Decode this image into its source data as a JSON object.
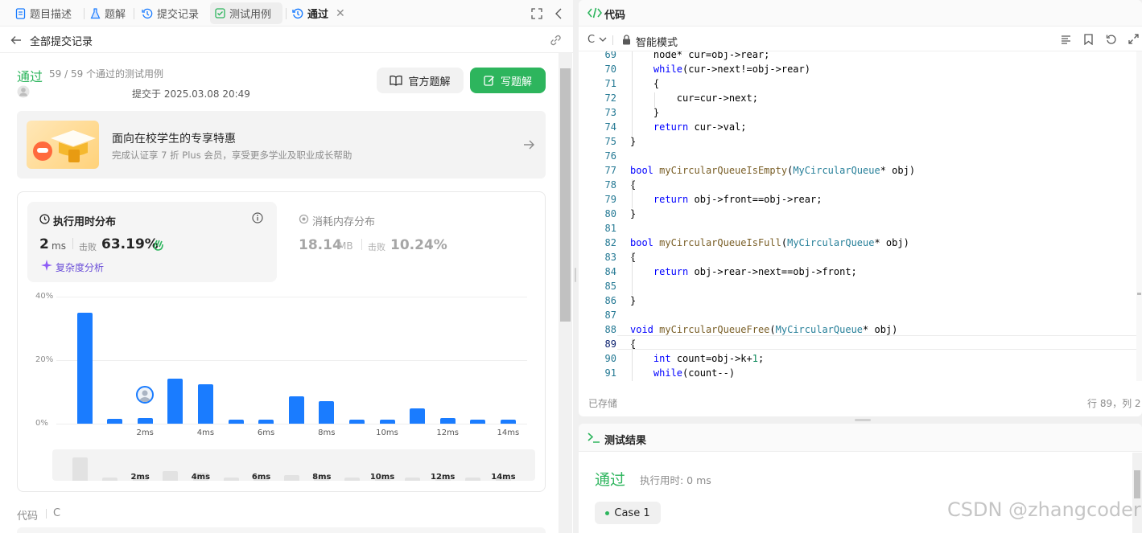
{
  "tabs": [
    {
      "label": "题目描述",
      "icon": "description-icon"
    },
    {
      "label": "题解",
      "icon": "flask-icon"
    },
    {
      "label": "提交记录",
      "icon": "history-icon"
    },
    {
      "label": "测试用例",
      "icon": "checkbox-icon"
    },
    {
      "label": "通过",
      "icon": "history-icon"
    }
  ],
  "back": {
    "label": "全部提交记录"
  },
  "submission": {
    "status": "通过",
    "cases": "59 / 59 个通过的测试用例",
    "submitted_at": "提交于 2025.03.08 20:49",
    "official_btn": "官方题解",
    "write_btn": "写题解"
  },
  "promo": {
    "title": "面向在校学生的专享特惠",
    "subtitle": "完成认证享 7 折 Plus 会员，享受更多学业及职业成长帮助"
  },
  "runtime": {
    "title": "执行用时分布",
    "value": "2",
    "unit": "ms",
    "beats_label": "击败",
    "beats": "63.19%",
    "analysis": "复杂度分析"
  },
  "memory": {
    "title": "消耗内存分布",
    "value": "18.14",
    "unit": "MB",
    "beats_label": "击败",
    "beats": "10.24%"
  },
  "chart_data": {
    "type": "bar",
    "ylim": [
      0,
      40
    ],
    "y_ticks": [
      "40%",
      "20%",
      "0%"
    ],
    "x_tick_labels": [
      "2ms",
      "4ms",
      "6ms",
      "8ms",
      "10ms",
      "12ms",
      "14ms"
    ],
    "values": [
      35,
      1.5,
      1.8,
      14.3,
      12.4,
      1.3,
      1.3,
      8.7,
      7.1,
      1.3,
      1.3,
      4.9,
      1.8,
      1.3,
      1.3
    ],
    "highlight_index": 2,
    "bar_color": "#1a7cff"
  },
  "code_section": {
    "label": "代码",
    "lang": "C"
  },
  "code_panel": {
    "title": "代码",
    "lang": "C",
    "mode": "智能模式",
    "saved": "已存储",
    "cursor": "行 89，列 2"
  },
  "code_lines": [
    {
      "n": "69",
      "html": "    node* cur=obj-&gt;rear;"
    },
    {
      "n": "70",
      "html": "    <span class=\"kw\">while</span>(cur-&gt;next!=obj-&gt;rear)"
    },
    {
      "n": "71",
      "html": "    {"
    },
    {
      "n": "72",
      "html": "        cur=cur-&gt;next;"
    },
    {
      "n": "73",
      "html": "    }"
    },
    {
      "n": "74",
      "html": "    <span class=\"kw\">return</span> cur-&gt;val;"
    },
    {
      "n": "75",
      "html": "}"
    },
    {
      "n": "76",
      "html": ""
    },
    {
      "n": "77",
      "html": "<span class=\"kw\">bool</span> <span class=\"fn\">myCircularQueueIsEmpty</span>(<span class=\"ty\">MyCircularQueue</span>* obj)"
    },
    {
      "n": "78",
      "html": "{"
    },
    {
      "n": "79",
      "html": "    <span class=\"kw\">return</span> obj-&gt;front==obj-&gt;rear;"
    },
    {
      "n": "80",
      "html": "}"
    },
    {
      "n": "81",
      "html": ""
    },
    {
      "n": "82",
      "html": "<span class=\"kw\">bool</span> <span class=\"fn\">myCircularQueueIsFull</span>(<span class=\"ty\">MyCircularQueue</span>* obj)"
    },
    {
      "n": "83",
      "html": "{"
    },
    {
      "n": "84",
      "html": "    <span class=\"kw\">return</span> obj-&gt;rear-&gt;next==obj-&gt;front;"
    },
    {
      "n": "85",
      "html": ""
    },
    {
      "n": "86",
      "html": "}"
    },
    {
      "n": "87",
      "html": ""
    },
    {
      "n": "88",
      "html": "<span class=\"kw\">void</span> <span class=\"fn\">myCircularQueueFree</span>(<span class=\"ty\">MyCircularQueue</span>* obj)"
    },
    {
      "n": "89",
      "html": "{"
    },
    {
      "n": "90",
      "html": "    <span class=\"kw\">int</span> count=obj-&gt;k+<span class=\"nu\">1</span>;"
    },
    {
      "n": "91",
      "html": "    <span class=\"kw\">while</span>(count--)"
    }
  ],
  "result": {
    "title": "测试结果",
    "status": "通过",
    "runtime": "执行用时: 0 ms",
    "case": "Case 1"
  },
  "watermark": "CSDN @zhangcoder"
}
